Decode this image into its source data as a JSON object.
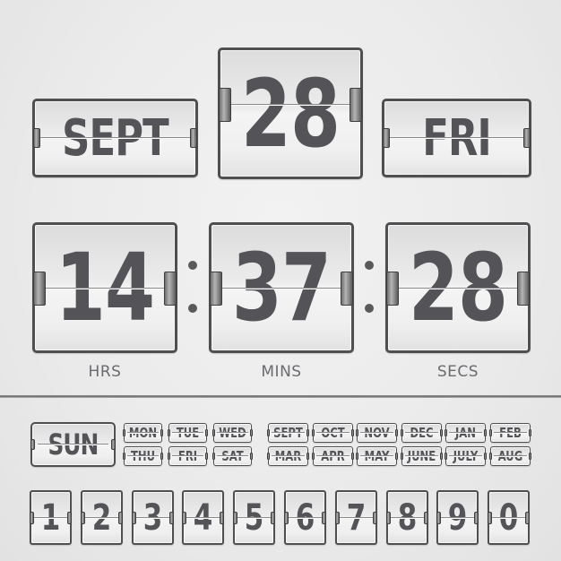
{
  "date": {
    "month": "SEPT",
    "day": "28",
    "weekday": "FRI"
  },
  "time": {
    "hours": "14",
    "minutes": "37",
    "seconds": "28",
    "separator": ":",
    "labels": {
      "hours": "HRS",
      "minutes": "MINS",
      "seconds": "SECS"
    }
  },
  "palette": {
    "weekdays_featured": "SUN",
    "weekdays": [
      "MON",
      "TUE",
      "WED",
      "THU",
      "FRI",
      "SAT"
    ],
    "months": [
      "SEPT",
      "OCT",
      "NOV",
      "DEC",
      "JAN",
      "FEB",
      "MAR",
      "APR",
      "MAY",
      "JUNE",
      "JULY",
      "AUG"
    ],
    "digits": [
      "1",
      "2",
      "3",
      "4",
      "5",
      "6",
      "7",
      "8",
      "9",
      "0"
    ]
  },
  "colors": {
    "ink": "#545458",
    "frame": "#4f4f52",
    "label": "#6b6b6f",
    "background": "#ebebeb"
  }
}
